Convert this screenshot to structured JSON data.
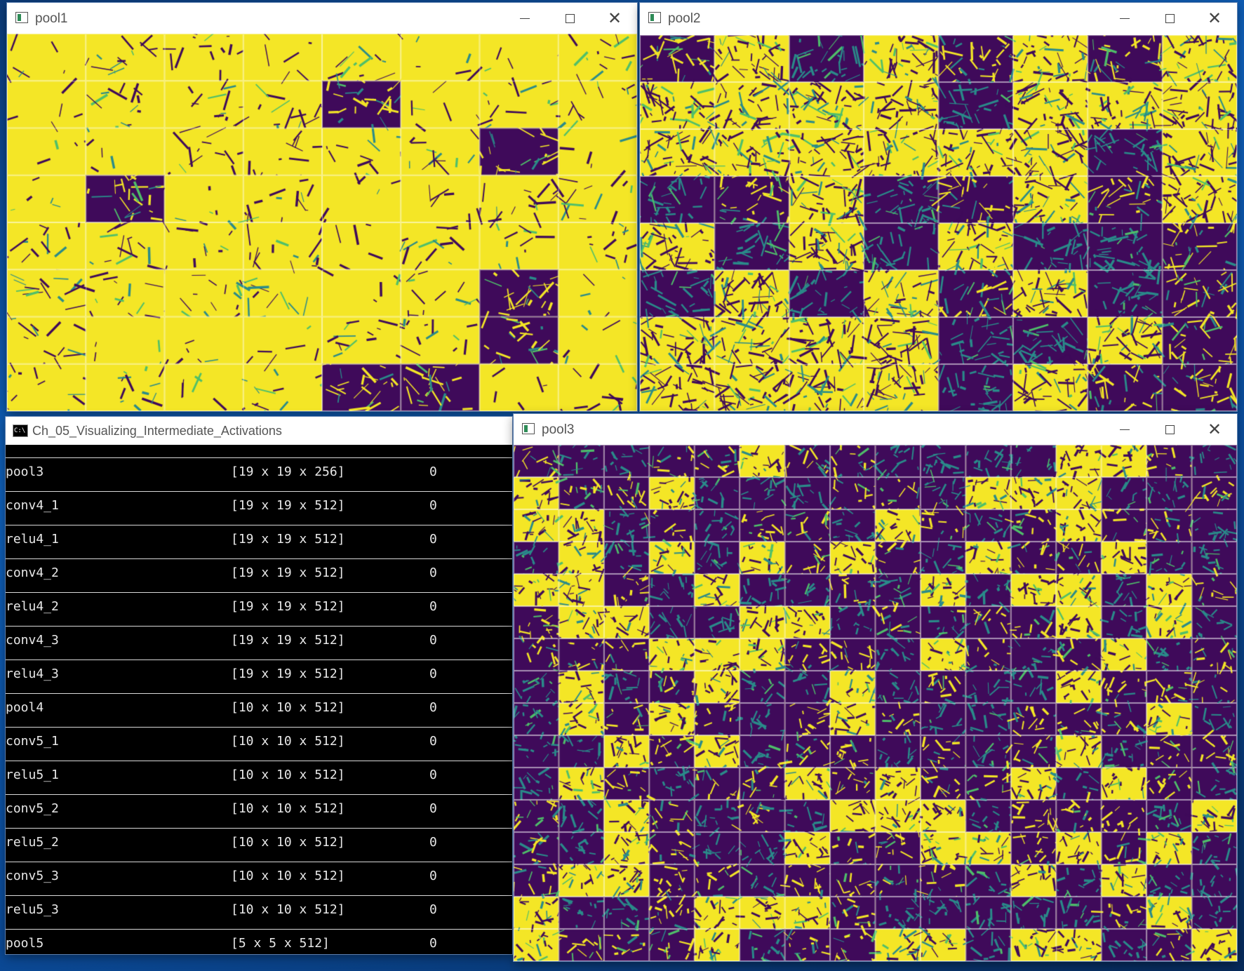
{
  "pool1": {
    "title": "pool1",
    "grid": {
      "cols": 8,
      "rows": 8
    }
  },
  "pool2": {
    "title": "pool2",
    "grid": {
      "cols": 8,
      "rows": 8
    }
  },
  "pool3": {
    "title": "pool3",
    "grid": {
      "cols": 16,
      "rows": 16
    }
  },
  "console": {
    "title": "Ch_05_Visualizing_Intermediate_Activations",
    "rows": [
      {
        "name": "pool3",
        "shape": "[19 x 19 x 256]",
        "params": "0"
      },
      {
        "name": "conv4_1",
        "shape": "[19 x 19 x 512]",
        "params": "0"
      },
      {
        "name": "relu4_1",
        "shape": "[19 x 19 x 512]",
        "params": "0"
      },
      {
        "name": "conv4_2",
        "shape": "[19 x 19 x 512]",
        "params": "0"
      },
      {
        "name": "relu4_2",
        "shape": "[19 x 19 x 512]",
        "params": "0"
      },
      {
        "name": "conv4_3",
        "shape": "[19 x 19 x 512]",
        "params": "0"
      },
      {
        "name": "relu4_3",
        "shape": "[19 x 19 x 512]",
        "params": "0"
      },
      {
        "name": "pool4",
        "shape": "[10 x 10 x 512]",
        "params": "0"
      },
      {
        "name": "conv5_1",
        "shape": "[10 x 10 x 512]",
        "params": "0"
      },
      {
        "name": "relu5_1",
        "shape": "[10 x 10 x 512]",
        "params": "0"
      },
      {
        "name": "conv5_2",
        "shape": "[10 x 10 x 512]",
        "params": "0"
      },
      {
        "name": "relu5_2",
        "shape": "[10 x 10 x 512]",
        "params": "0"
      },
      {
        "name": "conv5_3",
        "shape": "[10 x 10 x 512]",
        "params": "0"
      },
      {
        "name": "relu5_3",
        "shape": "[10 x 10 x 512]",
        "params": "0"
      },
      {
        "name": "pool5",
        "shape": "[5 x 5 x 512]",
        "params": "0"
      }
    ]
  },
  "colors": {
    "yellow": "#f4e626",
    "purple": "#3f0a5a",
    "teal": "#2a8b8a",
    "green": "#4fbf6a"
  },
  "icons": {
    "window": "app-window-icon",
    "console": "console-icon",
    "minimize": "minimize-icon",
    "maximize": "maximize-icon",
    "close": "close-icon"
  }
}
